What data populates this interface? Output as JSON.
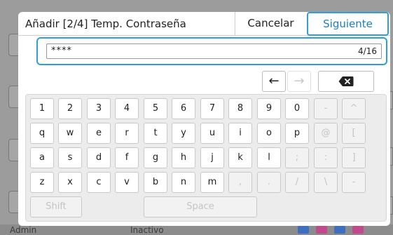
{
  "background": {
    "user_label": "Admin",
    "status_label": "Inactivo"
  },
  "dialog": {
    "title": "Añadir [2/4] Temp. Contraseña",
    "cancel_label": "Cancelar",
    "next_label": "Siguiente"
  },
  "input": {
    "value": "****",
    "counter": "4/16"
  },
  "controls": {
    "left_arrow": "←",
    "right_arrow": "→",
    "backspace_icon": "backspace-icon"
  },
  "keyboard": {
    "row1": [
      "1",
      "2",
      "3",
      "4",
      "5",
      "6",
      "7",
      "8",
      "9",
      "0",
      "-",
      "^"
    ],
    "row2": [
      "q",
      "w",
      "e",
      "r",
      "t",
      "y",
      "u",
      "i",
      "o",
      "p",
      "@",
      "["
    ],
    "row3": [
      "a",
      "s",
      "d",
      "f",
      "g",
      "h",
      "j",
      "k",
      "l",
      ";",
      ":",
      "]"
    ],
    "row4": [
      "z",
      "x",
      "c",
      "v",
      "b",
      "n",
      "m",
      ",",
      ".",
      "/",
      "\\",
      "-"
    ],
    "shift_label": "Shift",
    "space_label": "Space"
  },
  "colors": {
    "accent": "#2e9fd8",
    "accent_text": "#1a7fc0",
    "disabled_text": "#c4c4c4"
  }
}
